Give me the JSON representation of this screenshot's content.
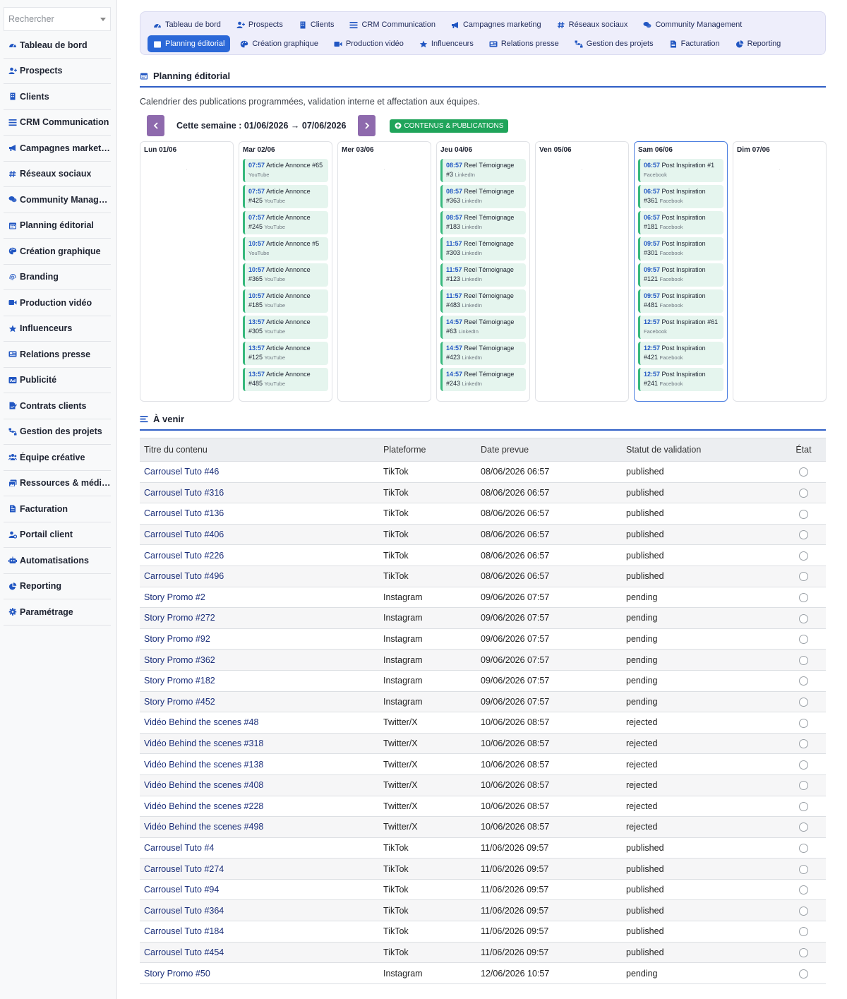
{
  "colors": {
    "accent": "#2b68d8",
    "section_rule": "#2f5fc6",
    "nav_arrow": "#8e6aad",
    "green": "#1fa45a",
    "post_bg": "#e5f5ee"
  },
  "sidebar": {
    "search_placeholder": "Rechercher",
    "items": [
      {
        "label": "Tableau de bord",
        "icon": "dashboard-icon"
      },
      {
        "label": "Prospects",
        "icon": "user-plus-icon"
      },
      {
        "label": "Clients",
        "icon": "building-icon"
      },
      {
        "label": "CRM Communication",
        "icon": "bars-icon"
      },
      {
        "label": "Campagnes marketing",
        "icon": "megaphone-icon"
      },
      {
        "label": "Réseaux sociaux",
        "icon": "hashtag-icon"
      },
      {
        "label": "Community Management",
        "icon": "comments-icon"
      },
      {
        "label": "Planning éditorial",
        "icon": "calendar-icon"
      },
      {
        "label": "Création graphique",
        "icon": "palette-icon"
      },
      {
        "label": "Branding",
        "icon": "fingerprint-icon"
      },
      {
        "label": "Production vidéo",
        "icon": "video-icon"
      },
      {
        "label": "Influenceurs",
        "icon": "star-icon"
      },
      {
        "label": "Relations presse",
        "icon": "newspaper-icon"
      },
      {
        "label": "Publicité",
        "icon": "ad-icon"
      },
      {
        "label": "Contrats clients",
        "icon": "file-signature-icon"
      },
      {
        "label": "Gestion des projets",
        "icon": "sitemap-icon"
      },
      {
        "label": "Équipe créative",
        "icon": "users-icon"
      },
      {
        "label": "Ressources & médias",
        "icon": "images-icon"
      },
      {
        "label": "Facturation",
        "icon": "invoice-icon"
      },
      {
        "label": "Portail client",
        "icon": "user-gear-icon"
      },
      {
        "label": "Automatisations",
        "icon": "robot-icon"
      },
      {
        "label": "Reporting",
        "icon": "chart-pie-icon"
      },
      {
        "label": "Paramétrage",
        "icon": "gear-icon"
      }
    ]
  },
  "topnav": {
    "tabs": [
      {
        "label": "Tableau de bord",
        "icon": "dashboard-icon",
        "active": false
      },
      {
        "label": "Prospects",
        "icon": "user-plus-icon",
        "active": false
      },
      {
        "label": "Clients",
        "icon": "building-icon",
        "active": false
      },
      {
        "label": "CRM Communication",
        "icon": "bars-icon",
        "active": false
      },
      {
        "label": "Campagnes marketing",
        "icon": "megaphone-icon",
        "active": false
      },
      {
        "label": "Réseaux sociaux",
        "icon": "hashtag-icon",
        "active": false
      },
      {
        "label": "Community Management",
        "icon": "comments-icon",
        "active": false
      },
      {
        "label": "Planning éditorial",
        "icon": "calendar-icon",
        "active": true
      },
      {
        "label": "Création graphique",
        "icon": "palette-icon",
        "active": false
      },
      {
        "label": "Production vidéo",
        "icon": "video-icon",
        "active": false
      },
      {
        "label": "Influenceurs",
        "icon": "star-icon",
        "active": false
      },
      {
        "label": "Relations presse",
        "icon": "newspaper-icon",
        "active": false
      },
      {
        "label": "Gestion des projets",
        "icon": "sitemap-icon",
        "active": false
      },
      {
        "label": "Facturation",
        "icon": "invoice-icon",
        "active": false
      },
      {
        "label": "Reporting",
        "icon": "chart-pie-icon",
        "active": false
      }
    ]
  },
  "planning": {
    "title": "Planning éditorial",
    "subtitle": "Calendrier des publications programmées, validation interne et affectation aux équipes.",
    "week_label": "Cette semaine : 01/06/2026 → 07/06/2026",
    "content_button": "CONTENUS & PUBLICATIONS",
    "empty_marker": "·",
    "days": [
      {
        "label": "Lun 01/06",
        "today": false,
        "posts": []
      },
      {
        "label": "Mar 02/06",
        "today": false,
        "posts": [
          {
            "time": "07:57",
            "title": "Article Annonce #65",
            "platform": "YouTube"
          },
          {
            "time": "07:57",
            "title": "Article Annonce #425",
            "platform": "YouTube"
          },
          {
            "time": "07:57",
            "title": "Article Annonce #245",
            "platform": "YouTube"
          },
          {
            "time": "10:57",
            "title": "Article Annonce #5",
            "platform": "YouTube"
          },
          {
            "time": "10:57",
            "title": "Article Annonce #365",
            "platform": "YouTube"
          },
          {
            "time": "10:57",
            "title": "Article Annonce #185",
            "platform": "YouTube"
          },
          {
            "time": "13:57",
            "title": "Article Annonce #305",
            "platform": "YouTube"
          },
          {
            "time": "13:57",
            "title": "Article Annonce #125",
            "platform": "YouTube"
          },
          {
            "time": "13:57",
            "title": "Article Annonce #485",
            "platform": "YouTube"
          }
        ]
      },
      {
        "label": "Mer 03/06",
        "today": false,
        "posts": []
      },
      {
        "label": "Jeu 04/06",
        "today": false,
        "posts": [
          {
            "time": "08:57",
            "title": "Reel Témoignage #3",
            "platform": "LinkedIn"
          },
          {
            "time": "08:57",
            "title": "Reel Témoignage #363",
            "platform": "LinkedIn"
          },
          {
            "time": "08:57",
            "title": "Reel Témoignage #183",
            "platform": "LinkedIn"
          },
          {
            "time": "11:57",
            "title": "Reel Témoignage #303",
            "platform": "LinkedIn"
          },
          {
            "time": "11:57",
            "title": "Reel Témoignage #123",
            "platform": "LinkedIn"
          },
          {
            "time": "11:57",
            "title": "Reel Témoignage #483",
            "platform": "LinkedIn"
          },
          {
            "time": "14:57",
            "title": "Reel Témoignage #63",
            "platform": "LinkedIn"
          },
          {
            "time": "14:57",
            "title": "Reel Témoignage #423",
            "platform": "LinkedIn"
          },
          {
            "time": "14:57",
            "title": "Reel Témoignage #243",
            "platform": "LinkedIn"
          }
        ]
      },
      {
        "label": "Ven 05/06",
        "today": false,
        "posts": []
      },
      {
        "label": "Sam 06/06",
        "today": true,
        "posts": [
          {
            "time": "06:57",
            "title": "Post Inspiration #1",
            "platform": "Facebook"
          },
          {
            "time": "06:57",
            "title": "Post Inspiration #361",
            "platform": "Facebook"
          },
          {
            "time": "06:57",
            "title": "Post Inspiration #181",
            "platform": "Facebook"
          },
          {
            "time": "09:57",
            "title": "Post Inspiration #301",
            "platform": "Facebook"
          },
          {
            "time": "09:57",
            "title": "Post Inspiration #121",
            "platform": "Facebook"
          },
          {
            "time": "09:57",
            "title": "Post Inspiration #481",
            "platform": "Facebook"
          },
          {
            "time": "12:57",
            "title": "Post Inspiration #61",
            "platform": "Facebook"
          },
          {
            "time": "12:57",
            "title": "Post Inspiration #421",
            "platform": "Facebook"
          },
          {
            "time": "12:57",
            "title": "Post Inspiration #241",
            "platform": "Facebook"
          }
        ]
      },
      {
        "label": "Dim 07/06",
        "today": false,
        "posts": []
      }
    ]
  },
  "upcoming": {
    "title": "À venir",
    "columns": [
      "Titre du contenu",
      "Plateforme",
      "Date prevue",
      "Statut de validation",
      "État"
    ],
    "rows": [
      [
        "Carrousel Tuto #46",
        "TikTok",
        "08/06/2026 06:57",
        "published"
      ],
      [
        "Carrousel Tuto #316",
        "TikTok",
        "08/06/2026 06:57",
        "published"
      ],
      [
        "Carrousel Tuto #136",
        "TikTok",
        "08/06/2026 06:57",
        "published"
      ],
      [
        "Carrousel Tuto #406",
        "TikTok",
        "08/06/2026 06:57",
        "published"
      ],
      [
        "Carrousel Tuto #226",
        "TikTok",
        "08/06/2026 06:57",
        "published"
      ],
      [
        "Carrousel Tuto #496",
        "TikTok",
        "08/06/2026 06:57",
        "published"
      ],
      [
        "Story Promo #2",
        "Instagram",
        "09/06/2026 07:57",
        "pending"
      ],
      [
        "Story Promo #272",
        "Instagram",
        "09/06/2026 07:57",
        "pending"
      ],
      [
        "Story Promo #92",
        "Instagram",
        "09/06/2026 07:57",
        "pending"
      ],
      [
        "Story Promo #362",
        "Instagram",
        "09/06/2026 07:57",
        "pending"
      ],
      [
        "Story Promo #182",
        "Instagram",
        "09/06/2026 07:57",
        "pending"
      ],
      [
        "Story Promo #452",
        "Instagram",
        "09/06/2026 07:57",
        "pending"
      ],
      [
        "Vidéo Behind the scenes #48",
        "Twitter/X",
        "10/06/2026 08:57",
        "rejected"
      ],
      [
        "Vidéo Behind the scenes #318",
        "Twitter/X",
        "10/06/2026 08:57",
        "rejected"
      ],
      [
        "Vidéo Behind the scenes #138",
        "Twitter/X",
        "10/06/2026 08:57",
        "rejected"
      ],
      [
        "Vidéo Behind the scenes #408",
        "Twitter/X",
        "10/06/2026 08:57",
        "rejected"
      ],
      [
        "Vidéo Behind the scenes #228",
        "Twitter/X",
        "10/06/2026 08:57",
        "rejected"
      ],
      [
        "Vidéo Behind the scenes #498",
        "Twitter/X",
        "10/06/2026 08:57",
        "rejected"
      ],
      [
        "Carrousel Tuto #4",
        "TikTok",
        "11/06/2026 09:57",
        "published"
      ],
      [
        "Carrousel Tuto #274",
        "TikTok",
        "11/06/2026 09:57",
        "published"
      ],
      [
        "Carrousel Tuto #94",
        "TikTok",
        "11/06/2026 09:57",
        "published"
      ],
      [
        "Carrousel Tuto #364",
        "TikTok",
        "11/06/2026 09:57",
        "published"
      ],
      [
        "Carrousel Tuto #184",
        "TikTok",
        "11/06/2026 09:57",
        "published"
      ],
      [
        "Carrousel Tuto #454",
        "TikTok",
        "11/06/2026 09:57",
        "published"
      ],
      [
        "Story Promo #50",
        "Instagram",
        "12/06/2026 10:57",
        "pending"
      ]
    ]
  }
}
